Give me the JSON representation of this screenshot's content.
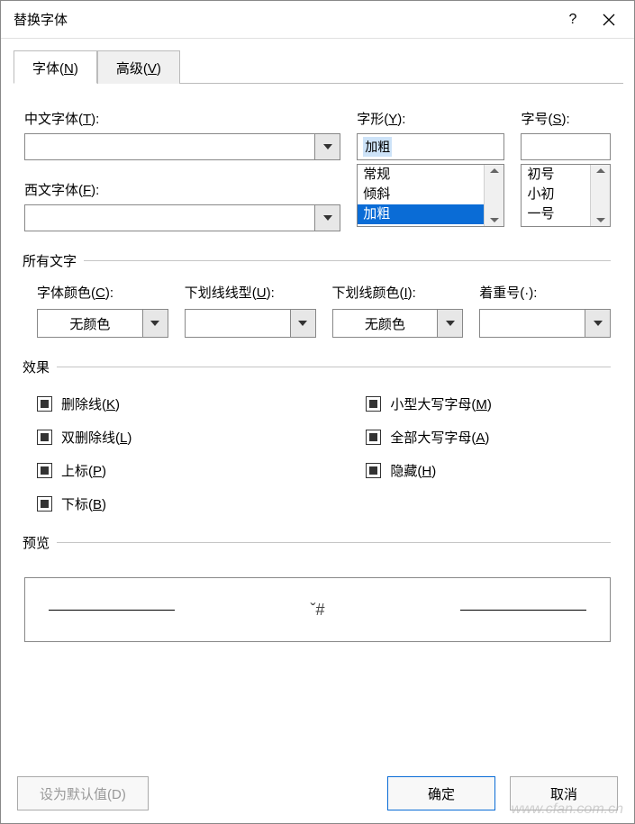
{
  "dialog": {
    "title": "替换字体",
    "help": "?",
    "close": "×"
  },
  "tabs": {
    "font": {
      "text": "字体(",
      "key": "N",
      "suffix": ")"
    },
    "advanced": {
      "text": "高级(",
      "key": "V",
      "suffix": ")"
    }
  },
  "labels": {
    "cn_font": "中文字体(",
    "cn_key": "T",
    "cn_suffix": "):",
    "en_font": "西文字体(",
    "en_key": "F",
    "en_suffix": "):",
    "style": "字形(",
    "style_key": "Y",
    "style_suffix": "):",
    "size": "字号(",
    "size_key": "S",
    "size_suffix": "):",
    "all_text": "所有文字",
    "font_color": "字体颜色(",
    "font_color_key": "C",
    "font_color_suffix": "):",
    "underline_style": "下划线线型(",
    "underline_key": "U",
    "underline_suffix": "):",
    "underline_color": "下划线颜色(",
    "ul_color_key": "I",
    "ul_color_suffix": "):",
    "emphasis": "着重号(·):",
    "effects": "效果",
    "preview": "预览"
  },
  "style_input": "加粗",
  "style_list": [
    "常规",
    "倾斜",
    "加粗"
  ],
  "size_list": [
    "初号",
    "小初",
    "一号"
  ],
  "dd_font_color": "无颜色",
  "dd_underline_style": "",
  "dd_underline_color": "无颜色",
  "dd_emphasis": "",
  "effects_left": [
    {
      "text": "删除线(",
      "key": "K",
      "suffix": ")"
    },
    {
      "text": "双删除线(",
      "key": "L",
      "suffix": ")"
    },
    {
      "text": "上标(",
      "key": "P",
      "suffix": ")"
    },
    {
      "text": "下标(",
      "key": "B",
      "suffix": ")"
    }
  ],
  "effects_right": [
    {
      "text": "小型大写字母(",
      "key": "M",
      "suffix": ")"
    },
    {
      "text": "全部大写字母(",
      "key": "A",
      "suffix": ")"
    },
    {
      "text": "隐藏(",
      "key": "H",
      "suffix": ")"
    }
  ],
  "preview_text": "ˇ#",
  "buttons": {
    "set_default": "设为默认值(D)",
    "ok": "确定",
    "cancel": "取消"
  },
  "watermark": "www.cfan.com.cn"
}
